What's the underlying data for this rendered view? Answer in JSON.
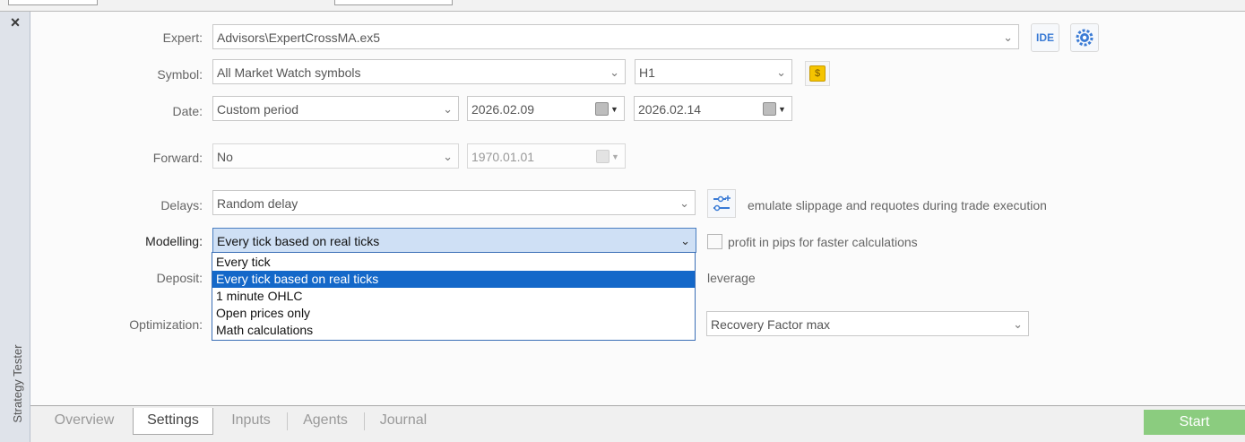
{
  "side_panel": {
    "close_glyph": "×",
    "title": "Strategy Tester"
  },
  "form": {
    "expert_label": "Expert:",
    "expert_value": "Advisors\\ExpertCrossMA.ex5",
    "ide_label": "IDE",
    "symbol_label": "Symbol:",
    "symbol_value": "All Market Watch symbols",
    "timeframe_value": "H1",
    "symbol_badge": "$",
    "date_label": "Date:",
    "date_mode": "Custom period",
    "date_from": "2026.02.09",
    "date_to": "2026.02.14",
    "forward_label": "Forward:",
    "forward_value": "No",
    "forward_date": "1970.01.01",
    "delays_label": "Delays:",
    "delays_value": "Random delay",
    "delays_note": "emulate slippage and requotes during trade execution",
    "modelling_label": "Modelling:",
    "modelling_value": "Every tick based on real ticks",
    "modelling_note": "profit in pips for faster calculations",
    "modelling_options": [
      "Every tick",
      "Every tick based on real ticks",
      "1 minute OHLC",
      "Open prices only",
      "Math calculations"
    ],
    "modelling_selected_index": 1,
    "deposit_label": "Deposit:",
    "leverage_label": "leverage",
    "optimization_label": "Optimization:",
    "optimization_criterion": "Recovery Factor max"
  },
  "tabs": [
    "Overview",
    "Settings",
    "Inputs",
    "Agents",
    "Journal"
  ],
  "active_tab": "Settings",
  "start_label": "Start",
  "colors": {
    "accent_blue": "#1468c9",
    "start_green": "#8bcc7f",
    "badge_yellow": "#f5c400"
  }
}
